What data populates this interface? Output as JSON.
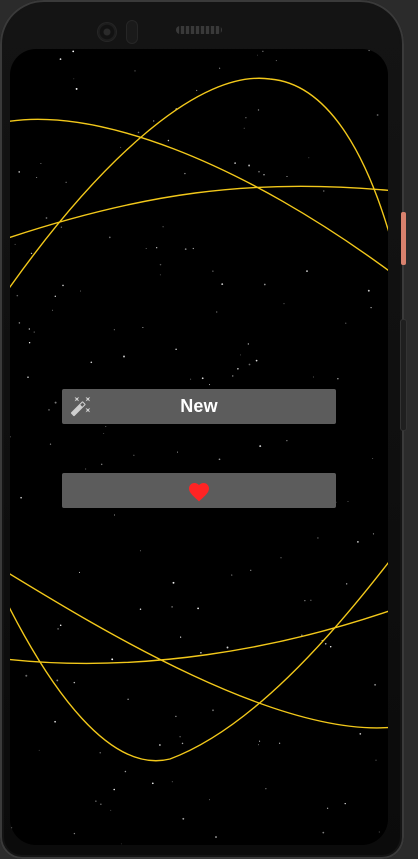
{
  "screen": {
    "new_button": {
      "label": "New",
      "icon": "magic-wand-icon"
    },
    "favorite_button": {
      "icon": "heart-icon",
      "icon_color": "#ff2424"
    }
  },
  "colors": {
    "background": "#000000",
    "orbit_line": "#f2c81a",
    "button_bg": "#5c5c5c",
    "button_text": "#ffffff",
    "stars": "#ffffff"
  }
}
